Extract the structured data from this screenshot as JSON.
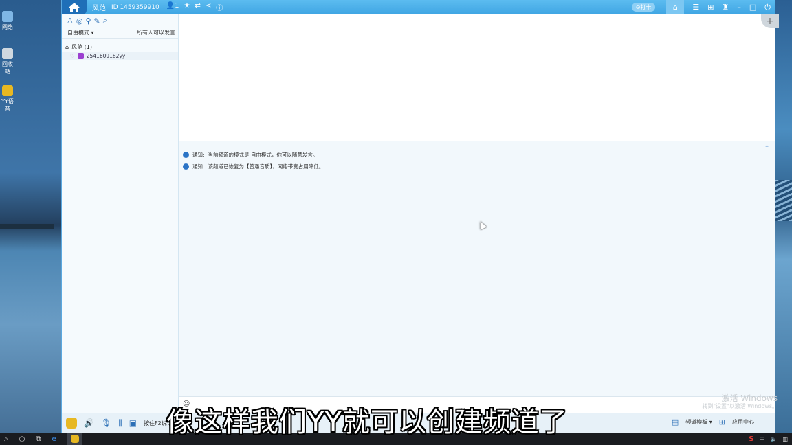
{
  "desktop": {
    "icons": [
      {
        "label": "网络",
        "icon": "network-icon"
      },
      {
        "label": "回收站",
        "icon": "recycle-bin-icon"
      },
      {
        "label": "YY语音",
        "icon": "yy-icon"
      }
    ]
  },
  "titlebar": {
    "channel_name": "风范",
    "channel_id": "ID 1459359910",
    "online_count": "1",
    "sign_button": "打卡",
    "icons": [
      "home-icon",
      "user-icon",
      "star-icon",
      "share-icon",
      "info-icon"
    ],
    "window_controls": [
      "home-tab-icon",
      "list-icon",
      "game-icon",
      "skin-icon",
      "minimize-icon",
      "restore-icon",
      "close-icon"
    ]
  },
  "sidebar": {
    "mode_label": "自由模式",
    "speak_rule": "所有人可以发言",
    "root_channel": "风范 (1)",
    "users": [
      {
        "name": "2541609182yy"
      }
    ]
  },
  "chat": {
    "messages": [
      {
        "prefix": "通知:",
        "text": "当前频道的模式是 自由模式，你可以随意发言。"
      },
      {
        "prefix": "通知:",
        "text": "该频道已恢复为【普通音质】，网络带宽占用降低。"
      }
    ]
  },
  "watermark": {
    "title": "激活 Windows",
    "subtitle": "转到\"设置\"以激活 Windows。"
  },
  "bottombar": {
    "hold_to_talk": "按住F2说话",
    "channel_template": "频道模板",
    "app_center": "应用中心"
  },
  "taskbar": {
    "ime": "中",
    "ime_brand": "S"
  },
  "subtitle": {
    "text": "像这样我们YY就可以创建频道了"
  },
  "colors": {
    "titlebar": "#3fa5e3",
    "accent": "#2b6fb6",
    "chat_bg": "#f2f8fc"
  }
}
